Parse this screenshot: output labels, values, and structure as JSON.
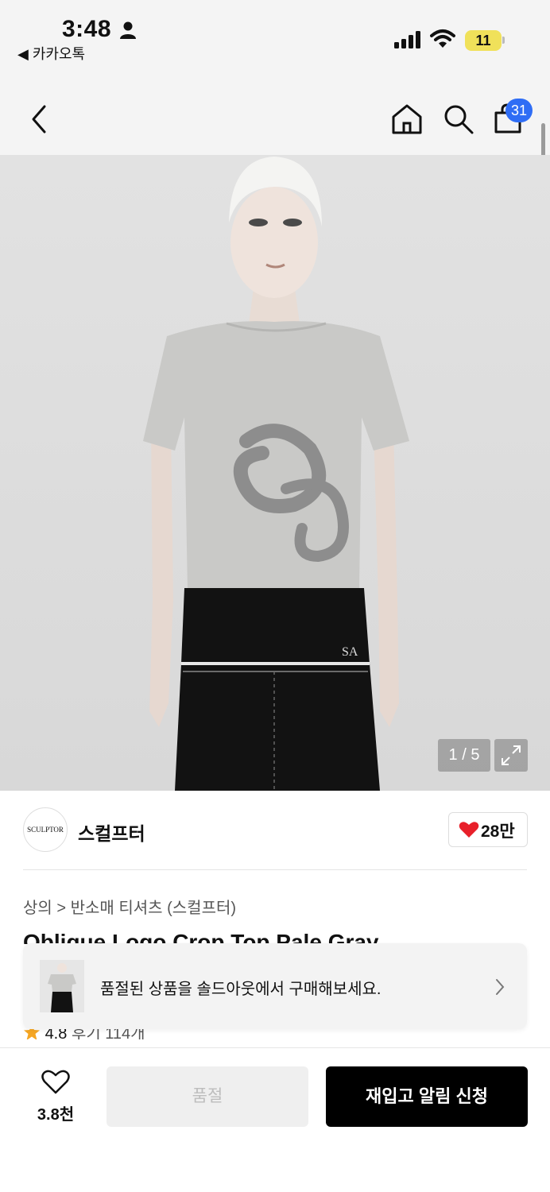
{
  "status_bar": {
    "time": "3:48",
    "back_app": "◀ 카카오톡",
    "battery": "11"
  },
  "nav": {
    "cart_count": "31"
  },
  "gallery": {
    "page_indicator": "1 / 5"
  },
  "brand": {
    "logo_text": "SCULPTOR",
    "name": "스컬프터",
    "like_count": "28만"
  },
  "breadcrumb": {
    "text": "상의 > 반소매 티셔츠 (스컬프터)"
  },
  "product": {
    "title": "Oblique Logo Crop Top Pale Gray",
    "rating": "4.8",
    "reviews": "후기 114개"
  },
  "soldout_banner": {
    "text": "품절된 상품을 솔드아웃에서 구매해보세요."
  },
  "bottom_bar": {
    "wish_count": "3.8천",
    "soldout_label": "품절",
    "restock_label": "재입고 알림 신청"
  },
  "colors": {
    "accent": "#2f6df5",
    "heart": "#e8202a",
    "star": "#f5a623"
  }
}
